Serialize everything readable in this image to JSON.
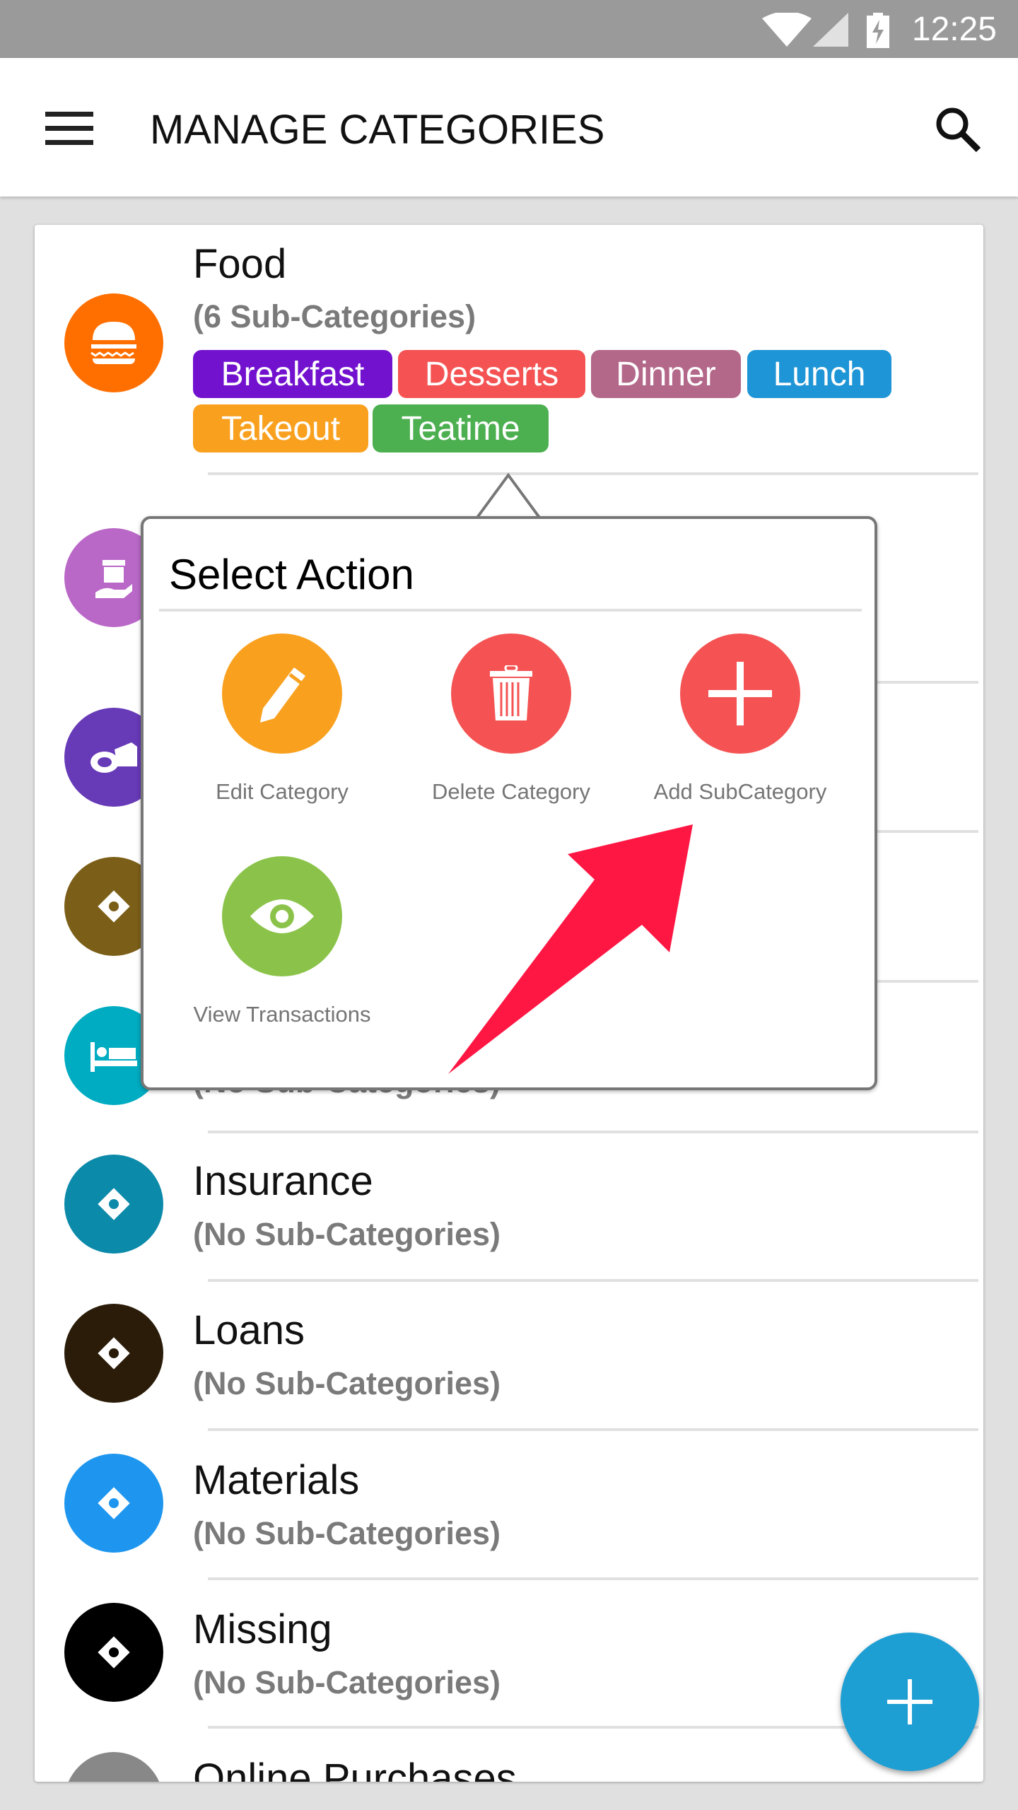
{
  "status_bar": {
    "time": "12:25",
    "icons": [
      "wifi-icon",
      "signal-icon",
      "battery-charging-icon"
    ]
  },
  "app_bar": {
    "title": "MANAGE CATEGORIES",
    "menu_icon": "hamburger-menu-icon",
    "search_icon": "search-icon"
  },
  "categories": [
    {
      "title": "Food",
      "subtitle": "(6 Sub-Categories)",
      "icon": "burger-icon",
      "color": "#ff6f00",
      "subcategories": [
        {
          "label": "Breakfast",
          "color": "#7212cf"
        },
        {
          "label": "Desserts",
          "color": "#f55353"
        },
        {
          "label": "Dinner",
          "color": "#b3688a"
        },
        {
          "label": "Lunch",
          "color": "#1e95d6"
        },
        {
          "label": "Takeout",
          "color": "#f9a11f"
        },
        {
          "label": "Teatime",
          "color": "#4caf50"
        }
      ]
    },
    {
      "icon": "gift-icon",
      "color": "#ba68c8"
    },
    {
      "icon": "meat-cheese-icon",
      "color": "#673ab7"
    },
    {
      "icon": "money-icon",
      "color": "#7b5e17"
    },
    {
      "subtitle": "(No Sub-Categories)",
      "icon": "bed-icon",
      "color": "#00acc1"
    },
    {
      "title": "Insurance",
      "subtitle": "(No Sub-Categories)",
      "icon": "money-icon",
      "color": "#0c8aaa"
    },
    {
      "title": "Loans",
      "subtitle": "(No Sub-Categories)",
      "icon": "money-icon",
      "color": "#2a1c08"
    },
    {
      "title": "Materials",
      "subtitle": "(No Sub-Categories)",
      "icon": "money-icon",
      "color": "#1e96ef"
    },
    {
      "title": "Missing",
      "subtitle": "(No Sub-Categories)",
      "icon": "money-icon",
      "color": "#000000"
    },
    {
      "title": "Online Purchases",
      "icon": "money-icon",
      "color": "#888888"
    }
  ],
  "popup": {
    "title": "Select Action",
    "actions": [
      {
        "label": "Edit Category",
        "icon": "pencil-icon",
        "color": "#f9a11f"
      },
      {
        "label": "Delete Category",
        "icon": "trash-icon",
        "color": "#f55353"
      },
      {
        "label": "Add SubCategory",
        "icon": "plus-icon",
        "color": "#f55353"
      },
      {
        "label": "View Transactions",
        "icon": "eye-icon",
        "color": "#8bc34a"
      }
    ]
  },
  "annotation": {
    "icon": "arrow-icon",
    "color": "#ff1744"
  },
  "fab": {
    "icon": "plus-icon",
    "color": "#1e9fd4"
  }
}
